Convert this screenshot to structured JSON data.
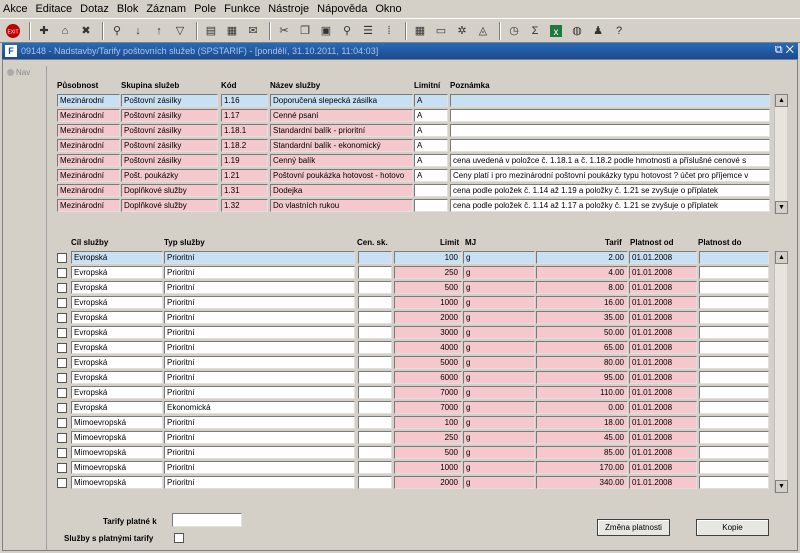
{
  "menu": [
    "Akce",
    "Editace",
    "Dotaz",
    "Blok",
    "Záznam",
    "Pole",
    "Funkce",
    "Nástroje",
    "Nápověda",
    "Okno"
  ],
  "window": {
    "title": "09148 - Nadstavby/Tarify poštovních služeb (SPSTARIF) - [pondělí, 31.10.2011, 11:04:03]",
    "nav_label": "Nav"
  },
  "upper": {
    "headers": [
      "Působnost",
      "Skupina služeb",
      "Kód",
      "Název služby",
      "Limitní",
      "Poznámka"
    ],
    "rows": [
      [
        "Mezinárodní",
        "Poštovní zásilky",
        "1.16",
        "Doporučená slepecká zásilka",
        "A",
        ""
      ],
      [
        "Mezinárodní",
        "Poštovní zásilky",
        "1.17",
        "Cenné psaní",
        "A",
        ""
      ],
      [
        "Mezinárodní",
        "Poštovní zásilky",
        "1.18.1",
        "Standardní balík - prioritní",
        "A",
        ""
      ],
      [
        "Mezinárodní",
        "Poštovní zásilky",
        "1.18.2",
        "Standardní balík - ekonomický",
        "A",
        ""
      ],
      [
        "Mezinárodní",
        "Poštovní zásilky",
        "1.19",
        "Cenný balík",
        "A",
        "cena uvedená v položce č. 1.18.1 a č. 1.18.2 podle hmotnosti a příslušné cenové s"
      ],
      [
        "Mezinárodní",
        "Pošt. poukázky",
        "1.21",
        "Poštovní poukázka hotovost - hotovo",
        "A",
        "Ceny platí i pro mezinárodní poštovní poukázky typu hotovost ? účet pro příjemce v"
      ],
      [
        "Mezinárodní",
        "Doplňkové služby",
        "1.31",
        "Dodejka",
        "",
        "cena podle položek č. 1.14 až 1.19 a položky č. 1.21 se zvyšuje o příplatek"
      ],
      [
        "Mezinárodní",
        "Doplňkové služby",
        "1.32",
        "Do vlastních rukou",
        "",
        "cena podle položek č. 1.14 až 1.17 a položky č. 1.21 se zvyšuje o příplatek"
      ]
    ]
  },
  "lower": {
    "headers": [
      "Cíl služby",
      "Typ služby",
      "Cen. sk.",
      "Limit",
      "MJ",
      "Tarif",
      "Platnost od",
      "Platnost do"
    ],
    "rows": [
      [
        "Evropská",
        "Prioritní",
        "",
        "100",
        "g",
        "2.00",
        "01.01.2008",
        ""
      ],
      [
        "Evropská",
        "Prioritní",
        "",
        "250",
        "g",
        "4.00",
        "01.01.2008",
        ""
      ],
      [
        "Evropská",
        "Prioritní",
        "",
        "500",
        "g",
        "8.00",
        "01.01.2008",
        ""
      ],
      [
        "Evropská",
        "Prioritní",
        "",
        "1000",
        "g",
        "16.00",
        "01.01.2008",
        ""
      ],
      [
        "Evropská",
        "Prioritní",
        "",
        "2000",
        "g",
        "35.00",
        "01.01.2008",
        ""
      ],
      [
        "Evropská",
        "Prioritní",
        "",
        "3000",
        "g",
        "50.00",
        "01.01.2008",
        ""
      ],
      [
        "Evropská",
        "Prioritní",
        "",
        "4000",
        "g",
        "65.00",
        "01.01.2008",
        ""
      ],
      [
        "Evropská",
        "Prioritní",
        "",
        "5000",
        "g",
        "80.00",
        "01.01.2008",
        ""
      ],
      [
        "Evropská",
        "Prioritní",
        "",
        "6000",
        "g",
        "95.00",
        "01.01.2008",
        ""
      ],
      [
        "Evropská",
        "Prioritní",
        "",
        "7000",
        "g",
        "110.00",
        "01.01.2008",
        ""
      ],
      [
        "Evropská",
        "Ekonomická",
        "",
        "7000",
        "g",
        "0.00",
        "01.01.2008",
        ""
      ],
      [
        "Mimoevropská",
        "Prioritní",
        "",
        "100",
        "g",
        "18.00",
        "01.01.2008",
        ""
      ],
      [
        "Mimoevropská",
        "Prioritní",
        "",
        "250",
        "g",
        "45.00",
        "01.01.2008",
        ""
      ],
      [
        "Mimoevropská",
        "Prioritní",
        "",
        "500",
        "g",
        "85.00",
        "01.01.2008",
        ""
      ],
      [
        "Mimoevropská",
        "Prioritní",
        "",
        "1000",
        "g",
        "170.00",
        "01.01.2008",
        ""
      ],
      [
        "Mimoevropská",
        "Prioritní",
        "",
        "2000",
        "g",
        "340.00",
        "01.01.2008",
        ""
      ]
    ]
  },
  "footer": {
    "tarify_label": "Tarify platné k",
    "tarify_value": "",
    "sluzby_label": "Služby s platnými tarify",
    "change_button": "Změna platnosti",
    "copy_button": "Kopie"
  },
  "colors": {
    "pink": "#f4c8cc",
    "selected": "#c8e0f4",
    "title": "#1a4a90"
  }
}
